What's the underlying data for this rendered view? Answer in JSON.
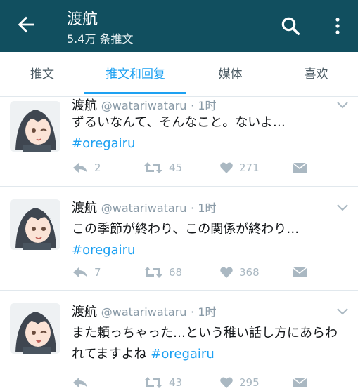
{
  "app": {
    "title": "渡航",
    "subtitle": "5.4万 条推文"
  },
  "tabs": [
    {
      "label": "推文",
      "active": false
    },
    {
      "label": "推文和回复",
      "active": true
    },
    {
      "label": "媒体",
      "active": false
    },
    {
      "label": "喜欢",
      "active": false
    }
  ],
  "tweets": [
    {
      "name": "渡航",
      "handle": "@watariwataru",
      "time": "· 1时",
      "text": "ずるいなんて、そんなこと。ないよ…",
      "hashtag": "#oregairu",
      "replies": "2",
      "retweets": "45",
      "likes": "271"
    },
    {
      "name": "渡航",
      "handle": "@watariwataru",
      "time": "· 1时",
      "text": "この季節が終わり、この関係が終わり…",
      "hashtag": "#oregairu",
      "replies": "7",
      "retweets": "68",
      "likes": "368"
    },
    {
      "name": "渡航",
      "handle": "@watariwataru",
      "time": "· 1时",
      "text": "また頼っちゃった…という稚い話し方にあらわれてますよね",
      "hashtag": "#oregairu",
      "replies": "",
      "retweets": "43",
      "likes": "295"
    }
  ],
  "colors": {
    "appbar": "#114f5f",
    "accent": "#1da1f2",
    "muted": "#aab8c2"
  },
  "icons": [
    "back-arrow-icon",
    "search-icon",
    "more-vert-icon",
    "chevron-down-icon",
    "reply-icon",
    "retweet-icon",
    "heart-icon",
    "direct-message-icon"
  ]
}
